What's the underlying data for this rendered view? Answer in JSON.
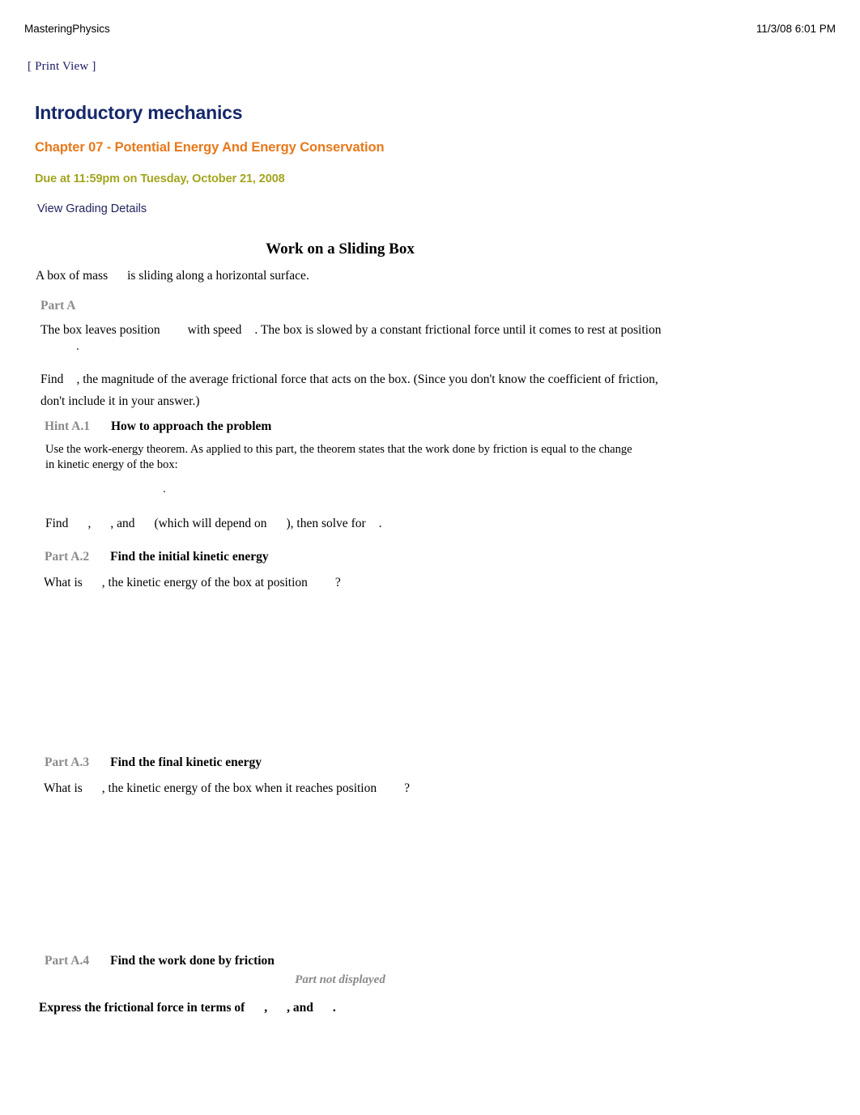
{
  "header": {
    "site_name": "MasteringPhysics",
    "timestamp": "11/3/08 6:01 PM",
    "print_view_label": "[ Print View ]"
  },
  "course": {
    "title": "Introductory mechanics",
    "chapter": "Chapter 07 - Potential Energy And Energy Conservation",
    "due": "Due at 11:59pm on Tuesday, October 21, 2008",
    "grading_link": "View Grading Details",
    "colors": {
      "course_title": "#16276b",
      "chapter": "#e8791b",
      "due": "#a2a51e",
      "link": "#232360",
      "part_number": "#8a8a8a"
    }
  },
  "problem": {
    "title": "Work on a Sliding Box",
    "intro_text_1": "A box of mass",
    "intro_text_2": "is sliding along a horizontal surface."
  },
  "part_a": {
    "label": "Part A",
    "statement_1": "The box leaves position",
    "statement_2": "with speed",
    "statement_3": ". The box is slowed by a constant frictional force until it comes to rest at position",
    "statement_4": ".",
    "question_1": "Find",
    "question_2": ", the magnitude of the average frictional force that acts on the box. (Since you don't know the coefficient of friction,",
    "question_3": "don't include it in your answer.)"
  },
  "hint_a1": {
    "number": "Hint A.1",
    "title": "How to approach the problem",
    "body_1": "Use the work-energy theorem. As applied to this part, the theorem states that the work done by friction is equal to the change",
    "body_2": "in kinetic energy of the box:",
    "equation_stub": ".",
    "follow_1": "Find",
    "follow_2": ",",
    "follow_3": ", and",
    "follow_4": "(which will depend on",
    "follow_5": "), then solve for",
    "follow_6": "."
  },
  "part_a2": {
    "number": "Part A.2",
    "title": "Find the initial kinetic energy",
    "question_1": "What is",
    "question_2": ", the kinetic energy of the box at position",
    "question_3": "?"
  },
  "part_a3": {
    "number": "Part A.3",
    "title": "Find the final kinetic energy",
    "question_1": "What is",
    "question_2": ", the kinetic energy of the box when it reaches position",
    "question_3": "?"
  },
  "part_a4": {
    "number": "Part A.4",
    "title": "Find the work done by friction",
    "status": "Part not displayed"
  },
  "final": {
    "instruction_1": "Express the frictional force in terms of",
    "instruction_2": ",",
    "instruction_3": ", and",
    "instruction_4": "."
  }
}
